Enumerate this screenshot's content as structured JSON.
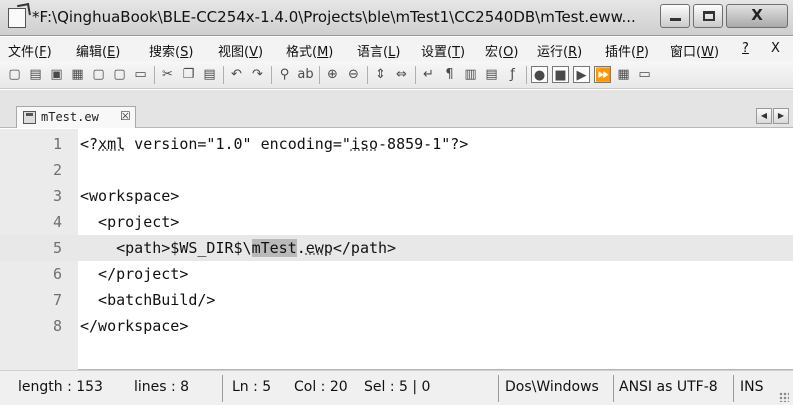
{
  "window": {
    "title": "*F:\\QinghuaBook\\BLE-CC254x-1.4.0\\Projects\\ble\\mTest1\\CC2540DB\\mTest.eww...",
    "close_glyph": "X"
  },
  "menu": [
    {
      "label": "文件(",
      "key": "F",
      "tail": ")"
    },
    {
      "label": "编辑(",
      "key": "E",
      "tail": ")"
    },
    {
      "label": "搜索(",
      "key": "S",
      "tail": ")"
    },
    {
      "label": "视图(",
      "key": "V",
      "tail": ")"
    },
    {
      "label": "格式(",
      "key": "M",
      "tail": ")"
    },
    {
      "label": "语言(",
      "key": "L",
      "tail": ")"
    },
    {
      "label": "设置(",
      "key": "T",
      "tail": ")"
    },
    {
      "label": "宏(",
      "key": "O",
      "tail": ")"
    },
    {
      "label": "运行(",
      "key": "R",
      "tail": ")"
    },
    {
      "label": "插件(",
      "key": "P",
      "tail": ")"
    },
    {
      "label": "窗口(",
      "key": "W",
      "tail": ")"
    },
    {
      "label": "",
      "key": "?",
      "tail": ""
    },
    {
      "label": "X",
      "key": "",
      "tail": ""
    }
  ],
  "toolbar": {
    "icons": [
      "new-file-icon",
      "open-file-icon",
      "save-icon",
      "save-all-icon",
      "close-icon",
      "close-all-icon",
      "print-icon",
      "cut-icon",
      "copy-icon",
      "paste-icon",
      "undo-icon",
      "redo-icon",
      "find-icon",
      "replace-icon",
      "zoom-in-icon",
      "zoom-out-icon",
      "sync-vertical-icon",
      "sync-horizontal-icon",
      "word-wrap-icon",
      "show-all-chars-icon",
      "indent-guide-icon",
      "doc-map-icon",
      "function-list-icon",
      "record-macro-icon",
      "stop-record-icon",
      "play-macro-icon",
      "run-macro-multiple-icon",
      "save-macro-icon",
      "launch-icon"
    ]
  },
  "tab": {
    "label": "mTest.ew",
    "close": "☒"
  },
  "editor": {
    "current_line": 5,
    "lines": [
      {
        "num": "1",
        "parts": [
          {
            "t": "<?"
          },
          {
            "t": "xml",
            "squig": true
          },
          {
            "t": " version=\"1.0\" encoding=\""
          },
          {
            "t": "iso",
            "squig": true
          },
          {
            "t": "-8859-1\"?>"
          }
        ]
      },
      {
        "num": "2",
        "parts": [
          {
            "t": ""
          }
        ]
      },
      {
        "num": "3",
        "parts": [
          {
            "t": "<workspace>"
          }
        ]
      },
      {
        "num": "4",
        "parts": [
          {
            "t": "  <project>"
          }
        ]
      },
      {
        "num": "5",
        "parts": [
          {
            "t": "    <path>$WS_DIR$\\"
          },
          {
            "t": "mTest",
            "hl": true
          },
          {
            "t": "."
          },
          {
            "t": "ewp",
            "squig": true
          },
          {
            "t": "</path>"
          }
        ]
      },
      {
        "num": "6",
        "parts": [
          {
            "t": "  </project>"
          }
        ]
      },
      {
        "num": "7",
        "parts": [
          {
            "t": "  <batchBuild/>"
          }
        ]
      },
      {
        "num": "8",
        "parts": [
          {
            "t": "</workspace>"
          }
        ]
      }
    ]
  },
  "status": {
    "length": "length : 153",
    "lines": "lines : 8",
    "ln": "Ln : 5",
    "col": "Col : 20",
    "sel": "Sel : 5 | 0",
    "eol": "Dos\\Windows",
    "encoding": "ANSI as UTF-8",
    "mode": "INS"
  }
}
